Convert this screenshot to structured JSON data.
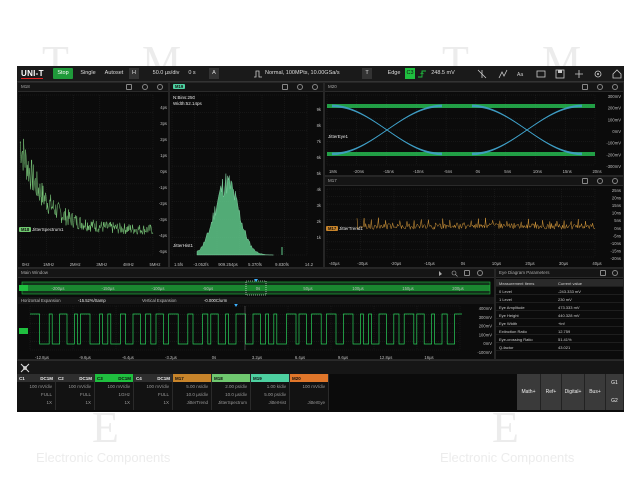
{
  "toolbar": {
    "brand": "UNI-T",
    "run_label": "Stop",
    "single_label": "Single",
    "autoset_label": "Autoset",
    "h_label": "H",
    "timebase": "50.0 µs/div",
    "h_offset": "0 s",
    "a_label": "A",
    "acq_mode": "Normal, 100MPts, 10.00GSa/s",
    "t_label": "T",
    "trigger_type": "Edge",
    "trigger_source": "C3",
    "trigger_level": "248.5 mV"
  },
  "panes": {
    "m18": {
      "title": "M18",
      "label": "JitterSpectrum1",
      "y_ticks": [
        "4ps",
        "3ps",
        "2ps",
        "1ps",
        "0ps",
        "-1ps",
        "-2ps",
        "-3ps",
        "-4ps",
        "-5ps"
      ],
      "x_ticks": [
        "0Hz",
        "1MHz",
        "2MHz",
        "3MHz",
        "4MHz",
        "5MHz"
      ]
    },
    "m19": {
      "title": "M19",
      "stats_n": "N:Bins:250",
      "stats_width": "Width:52.14ps",
      "label": "JitterHist1",
      "y_ticks": [
        "9k",
        "8k",
        "7k",
        "6k",
        "5k",
        "4k",
        "3k",
        "2k",
        "1k"
      ],
      "x_ticks": [
        "1.5fs",
        "-3.052fs",
        "909.254ps",
        "5.370fs",
        "9.830fs",
        "14.2"
      ]
    },
    "m20": {
      "title": "M20",
      "label": "JitterEye1",
      "y_ticks": [
        "300mV",
        "200mV",
        "100mV",
        "0mV",
        "-100mV",
        "-200mV",
        "-300mV"
      ],
      "x_ticks": [
        "1Ms",
        "-20ns",
        "-15ns",
        "-10ns",
        "-5ns",
        "0s",
        "5ns",
        "10ns",
        "15ns",
        "20ns"
      ]
    },
    "m17": {
      "title": "M17",
      "label": "JitterTrend1",
      "y_ticks": [
        "25ns",
        "20ns",
        "15ns",
        "10ns",
        "5ns",
        "0ns",
        "-5ns",
        "-10ns",
        "-15ns",
        "-20ns"
      ],
      "x_ticks": [
        "-40µs",
        "-30µs",
        "-20µs",
        "-10µs",
        "0s",
        "10µs",
        "20µs",
        "30µs",
        "40µs"
      ]
    }
  },
  "main_window": {
    "title": "Main Window",
    "overview_ticks": [
      "-200µs",
      "-150µs",
      "-100µs",
      "-50µs",
      "0s",
      "50µs",
      "100µs",
      "150µs",
      "200µs"
    ],
    "h_expansion_label": "Horizontal Expansion",
    "h_expansion_value": "-15.52%/Samp",
    "v_expansion_label": "Vertical Expansion",
    "v_expansion_value": "-0.000C/urm",
    "y_ticks": [
      "400mV",
      "300mV",
      "200mV",
      "100mV",
      "0mV",
      "-100mV"
    ],
    "x_ticks": [
      "-12.8µs",
      "-9.6µs",
      "-6.4µs",
      "-3.2µs",
      "0s",
      "3.2µs",
      "6.4µs",
      "9.6µs",
      "12.8µs",
      "16µs"
    ]
  },
  "eye_params": {
    "title": "Eye Diagram Parameters",
    "col_item": "Measurement Items",
    "col_value": "Current value",
    "rows": [
      {
        "item": "0 Level",
        "value": "-243.333 mV"
      },
      {
        "item": "1 Level",
        "value": "230 mV"
      },
      {
        "item": "Eye Amplitude",
        "value": "473.333 mV"
      },
      {
        "item": "Eye Height",
        "value": "440.328 mV"
      },
      {
        "item": "Eye Width",
        "value": "+inf"
      },
      {
        "item": "Extinction Ratio",
        "value": "12.759"
      },
      {
        "item": "Eye-crossing Ratio",
        "value": "51.41%"
      },
      {
        "item": "Q-factor",
        "value": "43.021"
      }
    ]
  },
  "channels": [
    {
      "name": "C1",
      "coupling": "DC1M",
      "scale": "100 mV/div",
      "bw": "FULL",
      "probe": "1X",
      "color": "#e5e53a"
    },
    {
      "name": "C2",
      "coupling": "DC1M",
      "scale": "100 mV/div",
      "bw": "FULL",
      "probe": "1X",
      "color": "#8ec5ff"
    },
    {
      "name": "C3",
      "coupling": "DC1M",
      "scale": "100 mV/div",
      "bw": "1GHz",
      "probe": "1X",
      "color": "#1fbf3f"
    },
    {
      "name": "C4",
      "coupling": "DC1M",
      "scale": "100 mV/div",
      "bw": "FULL",
      "probe": "1X",
      "color": "#ff7ab0"
    }
  ],
  "maths": [
    {
      "name": "M17",
      "scale": "5.00 ns/div",
      "offset": "10.0 µs/div",
      "source": "JitterTrend",
      "color": "#c8842a"
    },
    {
      "name": "M18",
      "scale": "2.00 ps/div",
      "offset": "10.0 µs/div",
      "source": "JitterSpectrum",
      "color": "#6fc86f"
    },
    {
      "name": "M19",
      "scale": "1.00 k/div",
      "offset": "5.00 ps/div",
      "source": "JitterHist",
      "color": "#4dd0a0"
    },
    {
      "name": "M20",
      "scale": "100 mV/div",
      "offset": "",
      "source": "JitterEye",
      "color": "#e0762a"
    }
  ],
  "right_buttons": {
    "math": "Math+",
    "ref": "Ref+",
    "digital": "Digital+",
    "bus": "Bus+",
    "g1": "G1",
    "g2": "G2"
  },
  "watermark": {
    "letters": [
      "T",
      "M",
      "T",
      "M",
      "E",
      "E"
    ],
    "footer": [
      "Electronic Components",
      "Electronic Components"
    ]
  }
}
